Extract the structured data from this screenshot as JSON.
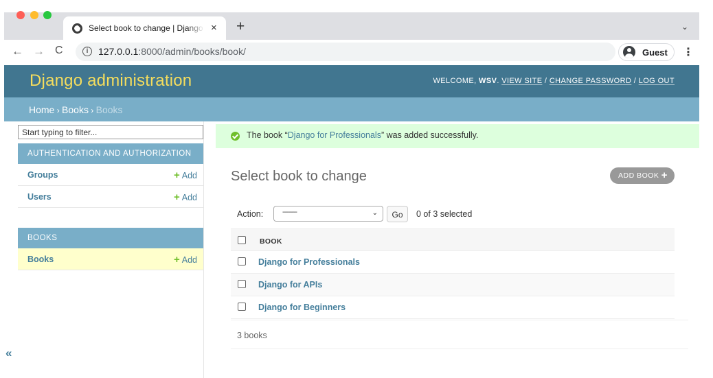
{
  "browser": {
    "tab_title": "Select book to change | Django site admin",
    "tab_close": "×",
    "new_tab": "+",
    "tab_menu": "⌄",
    "back": "←",
    "forward": "→",
    "reload": "C",
    "url_host": "127.0.0.1",
    "url_rest": ":8000/admin/books/book/",
    "profile": "Guest",
    "menu": "⋮",
    "info_icon": "i"
  },
  "header": {
    "branding": "Django administration",
    "welcome": "WELCOME,",
    "username": "WSV",
    "view_site": "VIEW SITE",
    "change_password": "CHANGE PASSWORD",
    "log_out": "LOG OUT",
    "sep1": ". ",
    "sep2": " / ",
    "sep3": " / "
  },
  "breadcrumbs": {
    "home": "Home",
    "app": "Books",
    "current": "Books",
    "separator": " › "
  },
  "sidebar": {
    "filter_placeholder": "Start typing to filter...",
    "sections": [
      {
        "caption": "AUTHENTICATION AND AUTHORIZATION",
        "models": [
          {
            "name": "Groups",
            "add": "Add"
          },
          {
            "name": "Users",
            "add": "Add"
          }
        ]
      },
      {
        "caption": "BOOKS",
        "models": [
          {
            "name": "Books",
            "add": "Add",
            "current": true
          }
        ]
      }
    ],
    "collapse": "«",
    "add_icon": "+"
  },
  "messages": {
    "success_prefix": "The book “",
    "success_object": "Django for Professionals",
    "success_suffix": "” was added successfully."
  },
  "content": {
    "title": "Select book to change",
    "add_button": "ADD BOOK",
    "add_icon": "+",
    "action_label": "Action:",
    "action_selected": "---------",
    "action_chevron": "⌄",
    "go_button": "Go",
    "selected_count": "0 of 3 selected",
    "column_header": "BOOK",
    "rows": [
      {
        "title": "Django for Professionals"
      },
      {
        "title": "Django for APIs"
      },
      {
        "title": "Django for Beginners"
      }
    ],
    "result_count": "3 books"
  },
  "colors": {
    "header_bg": "#417690",
    "branding": "#f5dd5d",
    "breadcrumbs_bg": "#79aec8",
    "link": "#447e9b",
    "success_bg": "#dddddd",
    "current_model_bg": "#ffffcc",
    "add_green": "#70bf2b"
  }
}
